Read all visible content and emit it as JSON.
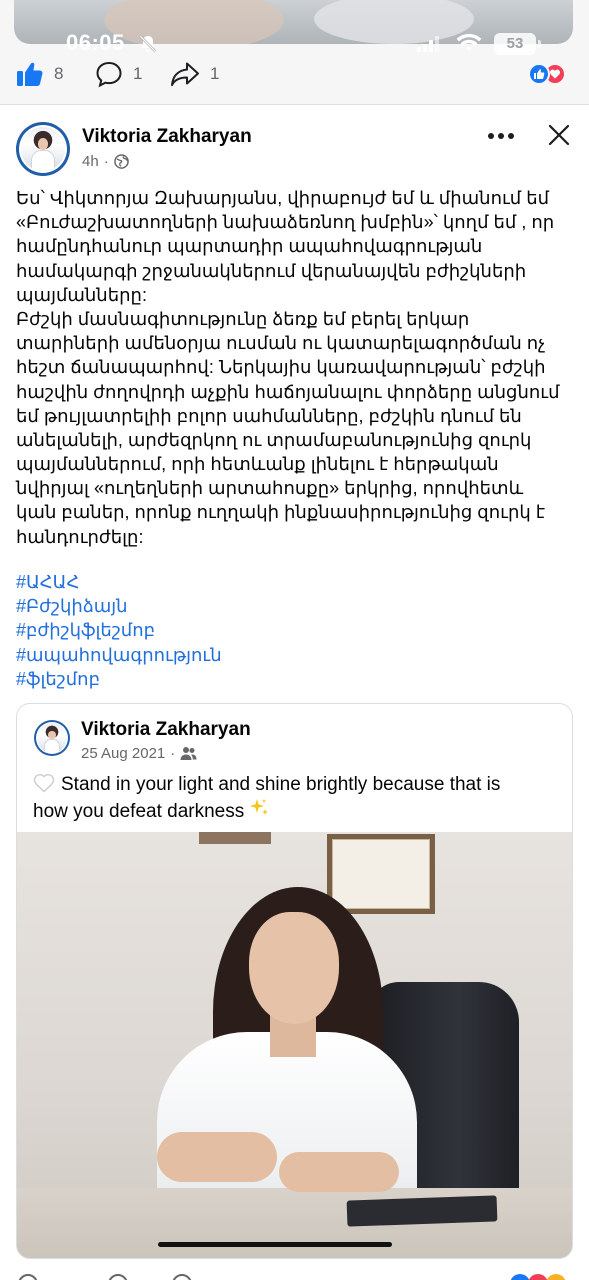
{
  "status_bar": {
    "time": "06:05",
    "battery": "53",
    "icons": [
      "mute-icon",
      "signal-icon",
      "wifi-icon",
      "battery-icon"
    ]
  },
  "previous_post": {
    "like_count": "8",
    "comment_count": "1",
    "share_count": "1",
    "reactions": [
      "like",
      "love"
    ]
  },
  "post": {
    "author": "Viktoria Zakharyan",
    "time": "4h",
    "audience_icon": "globe-icon",
    "text_lines": [
      "Ես՝ Վիկտորյա Զախարյանս, վիրաբույժ եմ և միանում եմ",
      "«Բուժաշխատողների նախաձեռնող խմբին»՝  կողմ եմ , որ",
      "համընդհանուր պարտադիր ապահովագրության",
      "համակարգի  շրջանակներում  վերանայվեն բժիշկների",
      "պայմանները:",
      "Բժշկի մասնագիտությունը ձեռք եմ բերել երկար",
      "տարիների ամենօրյա  ուսման ու կատարելագործման ոչ",
      "հեշտ ճանապարհով: Ներկայիս կառավարության՝ բժշկի",
      "հաշվին ժողովրդի աչքին հաճոյանալու փորձերը անցնում",
      "եմ թույլատրելիի բոլոր սահմանները, բժշկին դնում են",
      "անելանելի, արժեզրկող ու տրամաբանությունից զուրկ",
      "պայմաններում, որի հետևանք լինելու է հերթական",
      "նվիրյալ  «ուղեղների արտահոսքը»   երկրից, որովհետև",
      "կան բաներ, որոնք ուղղակի ինքնասիրությունից զուրկ է",
      "հանդուրժելը:"
    ],
    "hashtags": [
      "#ԱՀԱՀ",
      "#Բժշկիձայն",
      "#բժիշկֆլեշմոբ",
      "#ապահովագրություն",
      "#ֆլեշմոբ"
    ]
  },
  "shared_post": {
    "author": "Viktoria Zakharyan",
    "date": "25 Aug 2021",
    "audience_icon": "friends-icon",
    "text_line_1": "Stand in your light and shine brightly because that is",
    "text_line_2": "how you defeat darkness",
    "photo_description_icon": "doctor-photo"
  }
}
